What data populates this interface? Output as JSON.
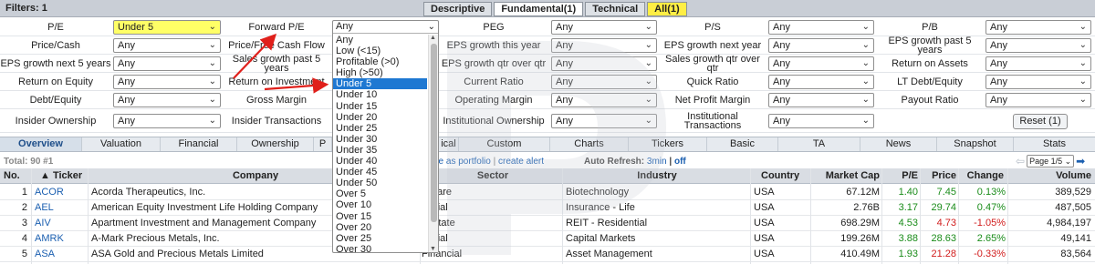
{
  "topbar": {
    "filters_label": "Filters: 1",
    "tabs": [
      "Descriptive",
      "Fundamental(1)",
      "Technical",
      "All(1)"
    ]
  },
  "filters": {
    "row1": [
      {
        "label": "P/E",
        "value": "Under 5"
      },
      {
        "label": "Forward P/E",
        "value": "Any"
      },
      {
        "label": "PEG",
        "value": "Any"
      },
      {
        "label": "P/S",
        "value": "Any"
      },
      {
        "label": "P/B",
        "value": "Any"
      }
    ],
    "row2": [
      {
        "label": "Price/Cash",
        "value": "Any"
      },
      {
        "label": "Price/Free Cash Flow",
        "value": ""
      },
      {
        "label": "EPS growth this year",
        "value": "Any"
      },
      {
        "label": "EPS growth next year",
        "value": "Any"
      },
      {
        "label": "EPS growth past 5 years",
        "value": "Any"
      }
    ],
    "row3": [
      {
        "label": "EPS growth next 5 years",
        "value": "Any"
      },
      {
        "label": "Sales growth past 5 years",
        "value": ""
      },
      {
        "label": "EPS growth qtr over qtr",
        "value": "Any"
      },
      {
        "label": "Sales growth qtr over qtr",
        "value": "Any"
      },
      {
        "label": "Return on Assets",
        "value": "Any"
      }
    ],
    "row4": [
      {
        "label": "Return on Equity",
        "value": "Any"
      },
      {
        "label": "Return on Investment",
        "value": ""
      },
      {
        "label": "Current Ratio",
        "value": "Any"
      },
      {
        "label": "Quick Ratio",
        "value": "Any"
      },
      {
        "label": "LT Debt/Equity",
        "value": "Any"
      }
    ],
    "row5": [
      {
        "label": "Debt/Equity",
        "value": "Any"
      },
      {
        "label": "Gross Margin",
        "value": ""
      },
      {
        "label": "Operating Margin",
        "value": "Any"
      },
      {
        "label": "Net Profit Margin",
        "value": "Any"
      },
      {
        "label": "Payout Ratio",
        "value": "Any"
      }
    ],
    "row6": [
      {
        "label": "Insider Ownership",
        "value": "Any"
      },
      {
        "label": "Insider Transactions",
        "value": ""
      },
      {
        "label": "Institutional Ownership",
        "value": "Any"
      },
      {
        "label": "Institutional Transactions",
        "value": "Any"
      }
    ],
    "reset_label": "Reset (1)"
  },
  "dropdown": {
    "current": "Any",
    "options": [
      "Any",
      "Low (<15)",
      "Profitable (>0)",
      "High (>50)",
      "Under 5",
      "Under 10",
      "Under 15",
      "Under 20",
      "Under 25",
      "Under 30",
      "Under 35",
      "Under 40",
      "Under 45",
      "Under 50",
      "Over 5",
      "Over 10",
      "Over 15",
      "Over 20",
      "Over 25",
      "Over 30"
    ],
    "selected": "Under 5"
  },
  "view_tabs": [
    "Overview",
    "Valuation",
    "Financial",
    "Ownership",
    "P",
    "ical",
    "Custom",
    "Charts",
    "Tickers",
    "Basic",
    "TA",
    "News",
    "Snapshot",
    "Stats"
  ],
  "results": {
    "total": "Total: 90 #1",
    "save_portfolio": "ave as portfolio",
    "separator": "|",
    "create_alert": "create alert",
    "auto_refresh_label": "Auto Refresh:",
    "auto_refresh_value": "3min",
    "auto_refresh_off": "off",
    "page": "Page 1/5"
  },
  "table": {
    "columns": [
      "No.",
      "▲ Ticker",
      "Company",
      "Sector",
      "Industry",
      "Country",
      "Market Cap",
      "P/E",
      "Price",
      "Change",
      "Volume"
    ],
    "rows": [
      {
        "no": "1",
        "ticker": "ACOR",
        "company": "Acorda Therapeutics, Inc.",
        "sector": "lthcare",
        "industry": "Biotechnology",
        "country": "USA",
        "mcap": "67.12M",
        "pe": "1.40",
        "price": "7.45",
        "change": "0.13%",
        "volume": "389,529",
        "dir": "pos"
      },
      {
        "no": "2",
        "ticker": "AEL",
        "company": "American Equity Investment Life Holding Company",
        "sector": "ancial",
        "industry": "Insurance - Life",
        "country": "USA",
        "mcap": "2.76B",
        "pe": "3.17",
        "price": "29.74",
        "change": "0.47%",
        "volume": "487,505",
        "dir": "pos"
      },
      {
        "no": "3",
        "ticker": "AIV",
        "company": "Apartment Investment and Management Company",
        "sector": "l Estate",
        "industry": "REIT - Residential",
        "country": "USA",
        "mcap": "698.29M",
        "pe": "4.53",
        "price": "4.73",
        "change": "-1.05%",
        "volume": "4,984,197",
        "dir": "neg"
      },
      {
        "no": "4",
        "ticker": "AMRK",
        "company": "A-Mark Precious Metals, Inc.",
        "sector": "ancial",
        "industry": "Capital Markets",
        "country": "USA",
        "mcap": "199.26M",
        "pe": "3.88",
        "price": "28.63",
        "change": "2.65%",
        "volume": "49,141",
        "dir": "pos"
      },
      {
        "no": "5",
        "ticker": "ASA",
        "company": "ASA Gold and Precious Metals Limited",
        "sector": "Financial",
        "industry": "Asset Management",
        "country": "USA",
        "mcap": "410.49M",
        "pe": "1.93",
        "price": "21.28",
        "change": "-0.33%",
        "volume": "83,564",
        "dir": "neg"
      }
    ]
  },
  "colors": {
    "highlight": "#ffff66",
    "positive": "#1a8c1a",
    "negative": "#d11c1c",
    "link": "#1b5fb0",
    "selected_option": "#1e78d2",
    "annotation_arrow": "#e0201b"
  }
}
